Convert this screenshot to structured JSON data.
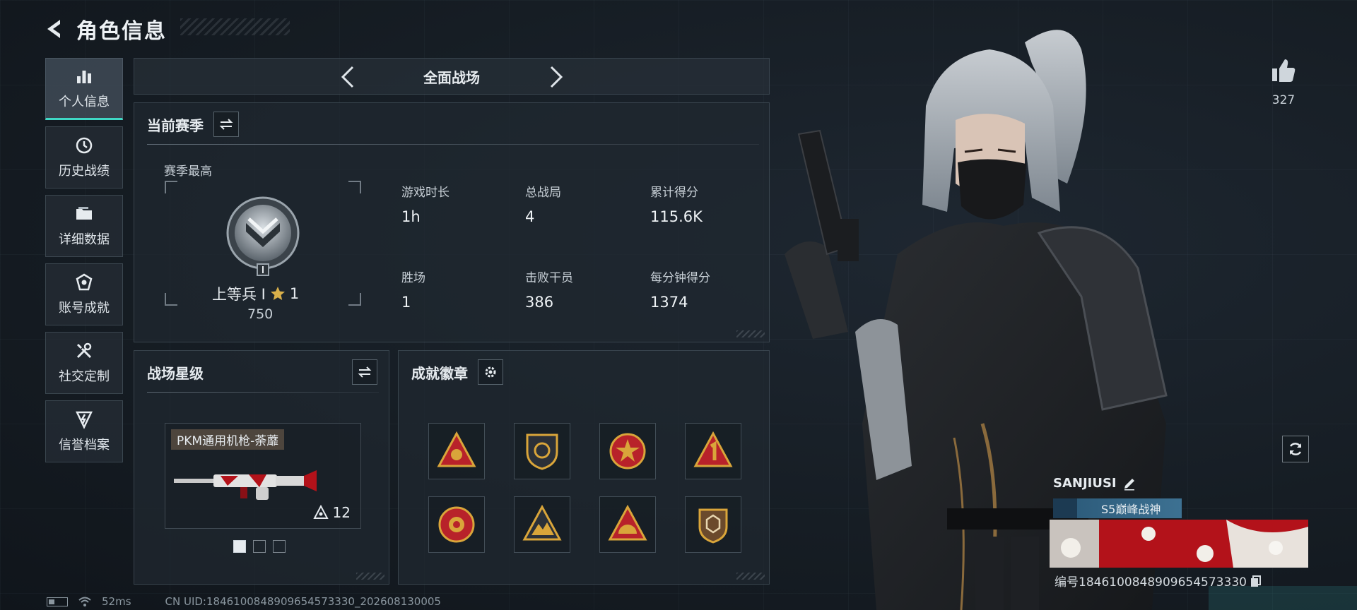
{
  "header": {
    "title": "角色信息"
  },
  "sidebar": {
    "items": [
      {
        "label": "个人信息",
        "icon": "bar-chart-icon",
        "active": true
      },
      {
        "label": "历史战绩",
        "icon": "history-clock-icon",
        "active": false
      },
      {
        "label": "详细数据",
        "icon": "folder-icon",
        "active": false
      },
      {
        "label": "账号成就",
        "icon": "achievement-emblem-icon",
        "active": false
      },
      {
        "label": "社交定制",
        "icon": "tools-icon",
        "active": false
      },
      {
        "label": "信誉档案",
        "icon": "shield-lightning-icon",
        "active": false
      }
    ]
  },
  "mode": {
    "title": "全面战场"
  },
  "season": {
    "title": "当前赛季",
    "best_label": "赛季最高",
    "rank_name": "上等兵 I",
    "rank_stars": "1",
    "rank_score": "750",
    "stats": [
      {
        "label": "游戏时长",
        "value": "1h"
      },
      {
        "label": "总战局",
        "value": "4"
      },
      {
        "label": "累计得分",
        "value": "115.6K"
      },
      {
        "label": "胜场",
        "value": "1"
      },
      {
        "label": "击败干员",
        "value": "386"
      },
      {
        "label": "每分钟得分",
        "value": "1374"
      }
    ]
  },
  "star_level": {
    "title": "战场星级",
    "weapon_name": "PKM通用机枪-荼蘼",
    "weapon_level": "12",
    "pages": 3,
    "current_page": 1
  },
  "achievements": {
    "title": "成就徽章",
    "badges": [
      "triangle-badge-icon",
      "shield-badge-icon",
      "star-medal-icon",
      "number-one-triangle-icon",
      "emblem-round-icon",
      "mountain-triangle-icon",
      "sunrise-triangle-icon",
      "hexagon-shield-icon"
    ]
  },
  "footer": {
    "ping": "52ms",
    "uid": "CN UID:1846100848909654573330_202608130005"
  },
  "player": {
    "likes": "327",
    "name": "SANJIUSI",
    "title": "S5巅峰战神",
    "id": "编号1846100848909654573330"
  },
  "colors": {
    "accent": "#3fd8c5",
    "gold": "#d9a53a",
    "banner_red": "#b3121a"
  }
}
